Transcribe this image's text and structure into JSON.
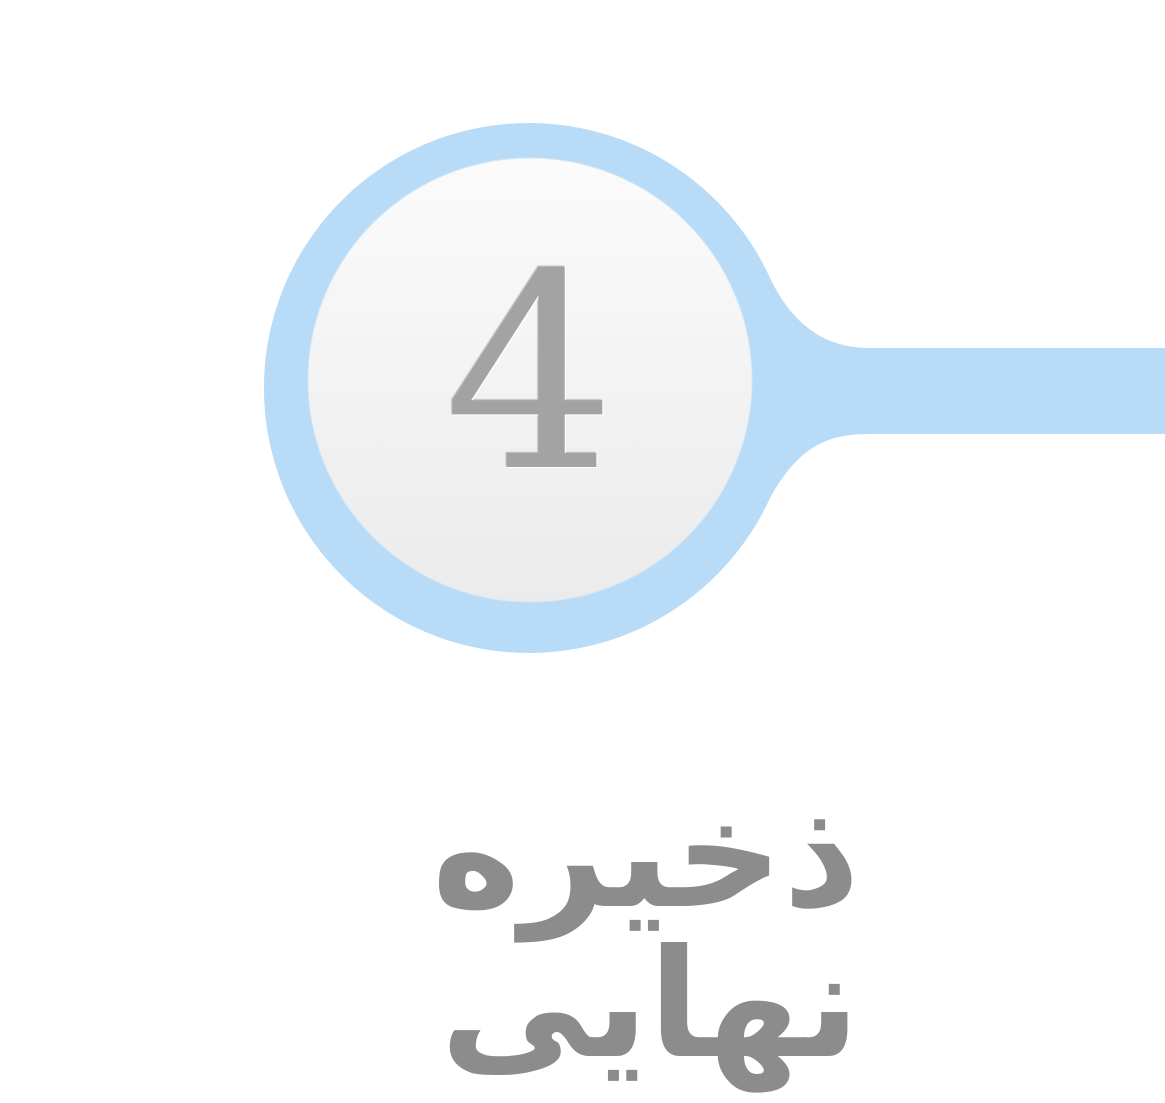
{
  "step": {
    "number": "4",
    "label": "ذخیره نهایی",
    "state": "inactive",
    "colors": {
      "ring": "#b8dcf8",
      "disc_top": "#fbfbfb",
      "disc_bottom": "#ebebeb",
      "number": "#a3a3a3",
      "label": "#8c8c8c"
    }
  }
}
